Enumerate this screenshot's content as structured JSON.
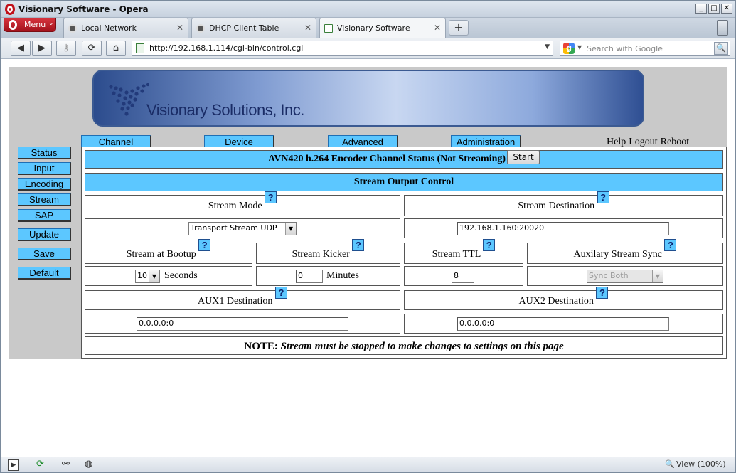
{
  "window": {
    "title": "Visionary Software - Opera",
    "min": "_",
    "max": "□",
    "close": "✕"
  },
  "menu": {
    "label": "Menu",
    "caret": "⌄"
  },
  "tabs": [
    {
      "label": "Local Network",
      "close": "✕"
    },
    {
      "label": "DHCP Client Table",
      "close": "✕"
    },
    {
      "label": "Visionary Software",
      "close": "✕"
    }
  ],
  "new_tab": "+",
  "nav": {
    "back": "◀",
    "forward": "▶",
    "key": "⚷",
    "reload": "⟳",
    "home": "⌂"
  },
  "address": {
    "url": "http://192.168.1.114/cgi-bin/control.cgi",
    "dropdown": "▼"
  },
  "search": {
    "placeholder": "Search with Google",
    "engine": "g",
    "caret": "▼",
    "go": "🔍"
  },
  "banner": {
    "text": "Visionary Solutions, Inc."
  },
  "top_nav": [
    "Channel",
    "Device",
    "Advanced",
    "Administration"
  ],
  "top_links": [
    "Help",
    "Logout",
    "Reboot"
  ],
  "side_nav": [
    "Status",
    "Input",
    "Encoding",
    "Stream",
    "SAP",
    "Update",
    "Save",
    "Default"
  ],
  "panel": {
    "status_title": "AVN420 h.264 Encoder Channel Status (Not Streaming)",
    "start_label": "Start",
    "section_title": "Stream Output Control",
    "help_glyph": "?",
    "stream_mode_label": "Stream Mode",
    "stream_mode_value": "Transport Stream UDP",
    "stream_dest_label": "Stream Destination",
    "stream_dest_value": "192.168.1.160:20020",
    "bootup_label": "Stream at Bootup",
    "bootup_value": "10",
    "bootup_unit": "Seconds",
    "kicker_label": "Stream Kicker",
    "kicker_value": "0",
    "kicker_unit": "Minutes",
    "ttl_label": "Stream TTL",
    "ttl_value": "8",
    "aux_sync_label": "Auxilary Stream Sync",
    "aux_sync_value": "Sync Both",
    "aux1_label": "AUX1 Destination",
    "aux1_value": "0.0.0.0:0",
    "aux2_label": "AUX2 Destination",
    "aux2_value": "0.0.0.0:0",
    "note_prefix": "NOTE:",
    "note_text": "Stream must be stopped to make changes to settings on this page"
  },
  "status_bar": {
    "view": "View (100%)"
  }
}
